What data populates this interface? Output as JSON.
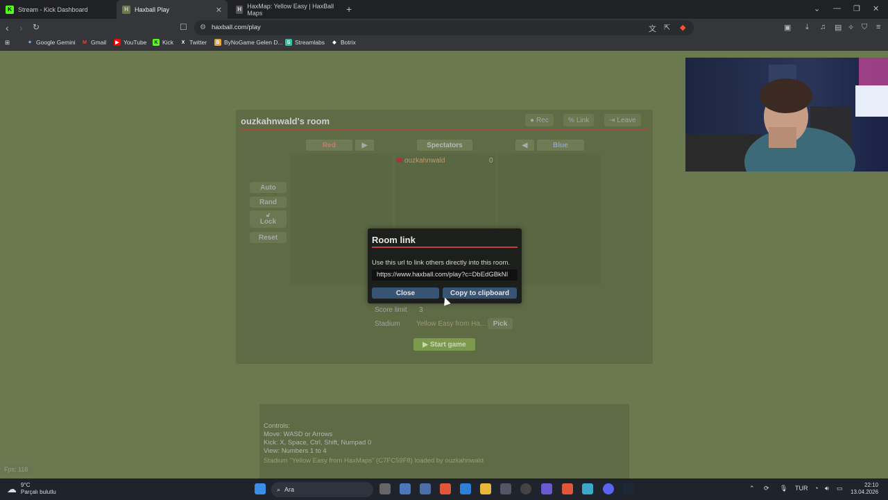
{
  "browser": {
    "tabs": [
      {
        "title": "Stream - Kick Dashboard",
        "favicon": "K",
        "color": "#53fc18"
      },
      {
        "title": "Haxball Play",
        "favicon": "H",
        "color": "#6b7a4e"
      },
      {
        "title": "HaxMap: Yellow Easy | HaxBall Maps",
        "favicon": "H",
        "color": "#666666"
      }
    ],
    "url": "haxball.com/play",
    "bookmarks": [
      {
        "label": "Google Gemini",
        "icon": "gemini-icon"
      },
      {
        "label": "Gmail",
        "icon": "gmail-icon"
      },
      {
        "label": "YouTube",
        "icon": "youtube-icon"
      },
      {
        "label": "Kick",
        "icon": "kick-icon"
      },
      {
        "label": "Twitter",
        "icon": "x-icon"
      },
      {
        "label": "ByNoGame Gelen D...",
        "icon": "bynogame-icon"
      },
      {
        "label": "Streamlabs",
        "icon": "streamlabs-icon"
      },
      {
        "label": "Botrix",
        "icon": "botrix-icon"
      }
    ]
  },
  "room": {
    "title": "ouzkahnwald's room",
    "buttons": {
      "rec": "Rec",
      "link": "Link",
      "leave": "Leave"
    },
    "teams": {
      "red": "Red",
      "spectators": "Spectators",
      "blue": "Blue"
    },
    "player": {
      "name": "ouzkahnwald",
      "score": "0"
    },
    "side_buttons": {
      "auto": "Auto",
      "rand": "Rand",
      "lock": "Lock",
      "reset": "Reset"
    },
    "options": {
      "score_limit_label": "Score limit",
      "score_limit_value": "3",
      "stadium_label": "Stadium",
      "stadium_value": "Yellow Easy from Ha...",
      "pick": "Pick"
    },
    "start": "Start game"
  },
  "modal": {
    "title": "Room link",
    "text": "Use this url to link others directly into this room.",
    "url": "https://www.haxball.com/play?c=DbEdGBkNI",
    "close": "Close",
    "copy": "Copy to clipboard"
  },
  "controls": {
    "lines": [
      "Controls:",
      "Move: WASD or Arrows",
      "Kick: X, Space, Ctrl, Shift, Numpad 0",
      "View: Numbers 1 to 4"
    ],
    "log": "Stadium \"Yellow Easy from HaxMaps\" (C7FC59F8) loaded by ouzkahnwald"
  },
  "fps": "Fps: 118",
  "taskbar": {
    "weather_temp": "9°C",
    "weather_desc": "Parçalı bulutlu",
    "search": "Ara",
    "lang": "TUR",
    "time": "22:10",
    "date": "13.04.2026"
  }
}
